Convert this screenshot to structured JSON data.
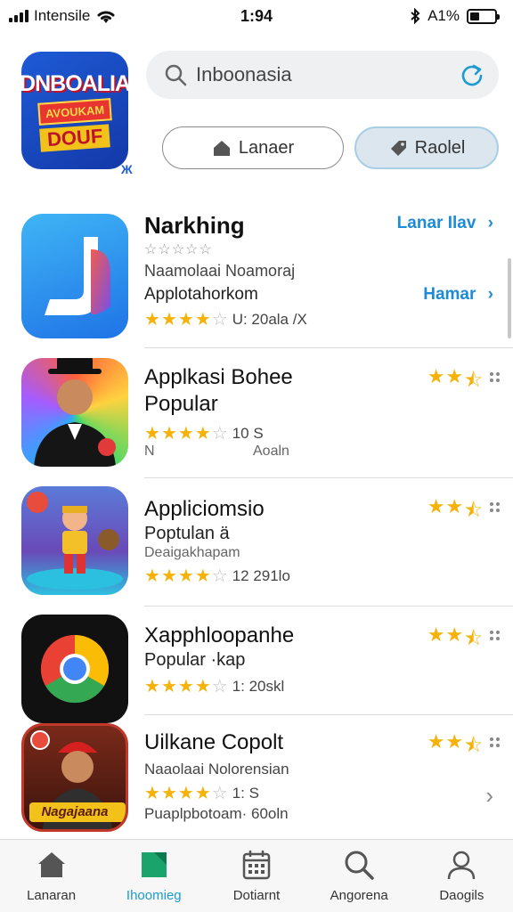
{
  "status_bar": {
    "carrier": "Intensile",
    "time": "1:94",
    "battery_text": "A1%"
  },
  "header": {
    "hero": {
      "line1": "DNBOALIA",
      "line2": "AVOUKAM",
      "line3": "DOUF",
      "mark": "Ж"
    },
    "search": {
      "value": "Inboonasia"
    },
    "segment_left": "Lanaer",
    "segment_right": "Raolel"
  },
  "apps": [
    {
      "title": "Narkhing",
      "small_rating": "☆☆☆☆☆",
      "sub1": "Naamolaai Noamoraj",
      "sub2": "Applotahorkom",
      "rating_text": "U: 20ala /X",
      "link1": "Lanar Ilav",
      "link2": "Hamar"
    },
    {
      "title": "Applkasi Bohee",
      "title2": "Popular",
      "rating_text": "10 S",
      "foot_left": "N",
      "foot_right": "Aoaln"
    },
    {
      "title": "Appliciomsio",
      "sub1": "Poptulan ä",
      "sub2": "Deaigakhapam",
      "rating_text": "12 291lo"
    },
    {
      "title": "Xapphloopanhe",
      "sub1": "Popular ·kap",
      "rating_text": "1: 20skl"
    },
    {
      "title": "Uilkane Copolt",
      "sub1": "Naaolaai Nolorensian",
      "rating_text": "1: S",
      "sub2": "Puaplpbotoam·  60oln",
      "icon_text": "Nagajaana"
    }
  ],
  "tabs": [
    {
      "label": "Lanaran",
      "icon": "home-icon"
    },
    {
      "label": "Ihoomieg",
      "icon": "bookmark-icon"
    },
    {
      "label": "Dotiarnt",
      "icon": "calendar-icon"
    },
    {
      "label": "Angorena",
      "icon": "search-icon"
    },
    {
      "label": "Daogils",
      "icon": "person-icon"
    }
  ],
  "colors": {
    "accent": "#1d9bd1",
    "star": "#f5b20a",
    "link": "#1d8bd6"
  }
}
